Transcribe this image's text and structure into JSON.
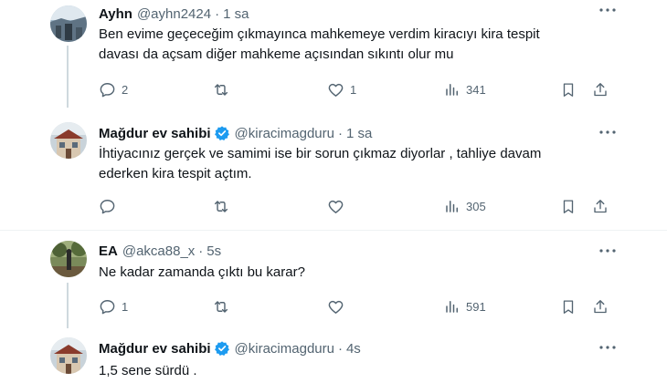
{
  "tweets": [
    {
      "name": "Ayhn",
      "handle": "@ayhn2424",
      "dot": "·",
      "time": "1 sa",
      "verified": false,
      "lines": [
        "Ben evime geçeceğim  çıkmayınca mahkemeye verdim kiracıyı kira tespit",
        "davası da açsam diğer mahkeme açısından sıkıntı olur mu"
      ],
      "replies": "2",
      "retweets": "",
      "likes": "1",
      "views": "341"
    },
    {
      "name": "Mağdur ev sahibi",
      "handle": "@kiracimagduru",
      "dot": "·",
      "time": "1 sa",
      "verified": true,
      "lines": [
        "İhtiyacınız gerçek ve samimi ise bir sorun çıkmaz diyorlar  , tahliye davam",
        "ederken kira tespit açtım."
      ],
      "replies": "",
      "retweets": "",
      "likes": "",
      "views": "305"
    },
    {
      "name": "EA",
      "handle": "@akca88_x",
      "dot": "·",
      "time": "5s",
      "verified": false,
      "lines": [
        "Ne kadar zamanda çıktı bu karar?"
      ],
      "replies": "1",
      "retweets": "",
      "likes": "",
      "views": "591"
    },
    {
      "name": "Mağdur ev sahibi",
      "handle": "@kiracimagduru",
      "dot": "·",
      "time": "4s",
      "verified": true,
      "lines": [
        "1,5 sene sürdü ."
      ]
    }
  ],
  "colors": {
    "text": "#0f1419",
    "secondary": "#536471",
    "verified": "#1d9bf0",
    "thread_line": "#cfd9de"
  }
}
